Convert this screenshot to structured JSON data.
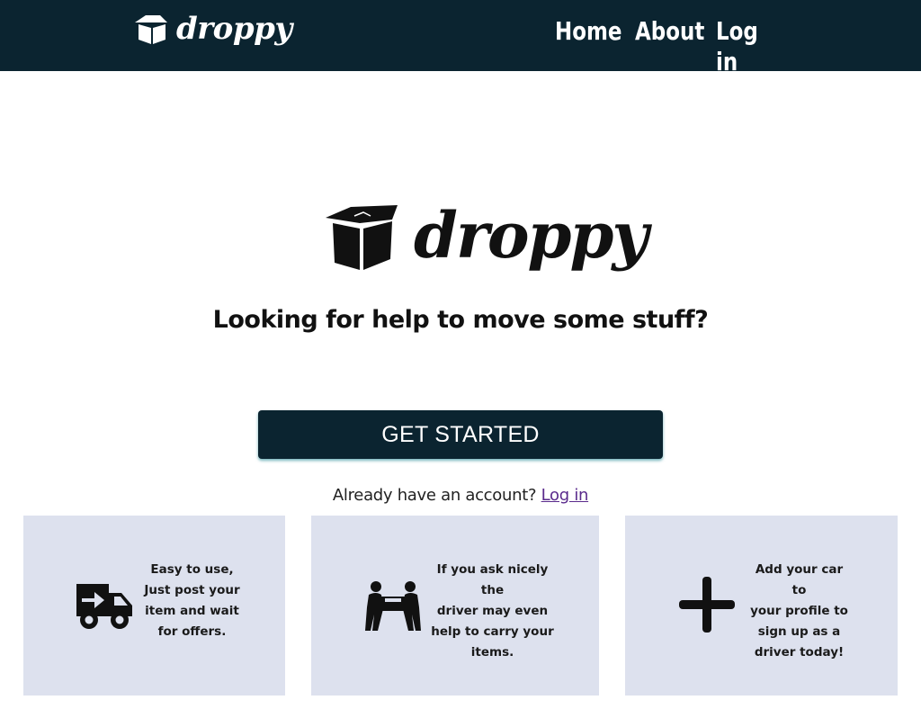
{
  "header": {
    "brand": "droppy",
    "nav": {
      "home": "Home",
      "about": "About",
      "login": "Log in"
    }
  },
  "hero": {
    "brand": "droppy",
    "headline": "Looking for help to move some stuff?",
    "cta_label": "GET STARTED",
    "account_prompt": "Already have an account?",
    "account_link": "Log in"
  },
  "features": [
    {
      "icon": "truck-arrow-icon",
      "lines": [
        "Easy to use,",
        "Just post your",
        "item and wait",
        "for offers."
      ]
    },
    {
      "icon": "people-carry-icon",
      "lines": [
        "If you ask nicely the",
        "driver may even",
        "help to carry your",
        "items."
      ]
    },
    {
      "icon": "plus-icon",
      "lines": [
        "Add your car to",
        "your profile to",
        "sign up as a",
        "driver today!"
      ]
    }
  ],
  "colors": {
    "navbar": "#0b2430",
    "card_background": "#dde1ee",
    "link": "#5a2a8c"
  }
}
